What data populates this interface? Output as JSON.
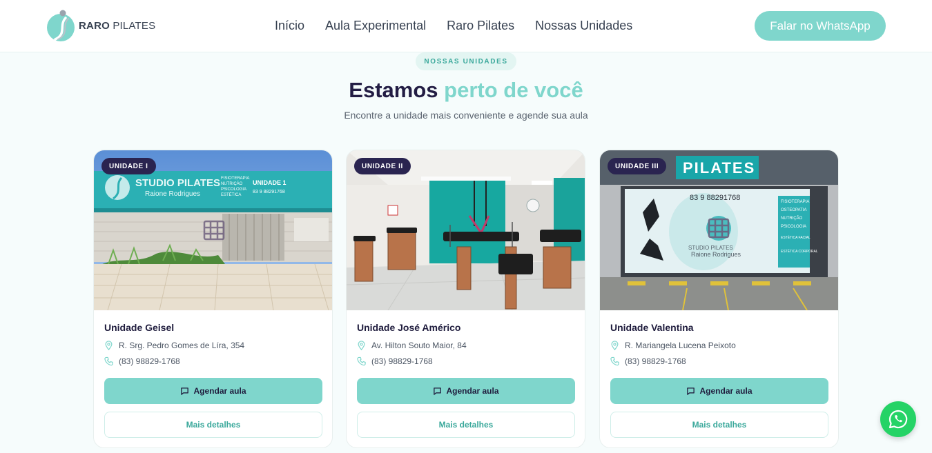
{
  "header": {
    "logo_bold": "RARO",
    "logo_light": "PILATES",
    "nav": [
      "Início",
      "Aula Experimental",
      "Raro Pilates",
      "Nossas Unidades"
    ],
    "cta_label": "Falar no WhatsApp"
  },
  "section": {
    "badge": "NOSSAS UNIDADES",
    "title_main": "Estamos",
    "title_accent": "perto de você",
    "subtitle": "Encontre a unidade mais conveniente e agende sua aula"
  },
  "units": [
    {
      "tag": "UNIDADE I",
      "name": "Unidade Geisel",
      "address": "R. Srg. Pedro Gomes de Líra, 354",
      "phone": "(83) 98829-1768",
      "primary_label": "Agendar aula",
      "secondary_label": "Mais detalhes"
    },
    {
      "tag": "UNIDADE II",
      "name": "Unidade José Américo",
      "address": "Av. Hilton Souto Maior, 84",
      "phone": "(83) 98829-1768",
      "primary_label": "Agendar aula",
      "secondary_label": "Mais detalhes"
    },
    {
      "tag": "UNIDADE III",
      "name": "Unidade Valentina",
      "address": "R. Mariangela Lucena Peixoto",
      "phone": "(83) 98829-1768",
      "primary_label": "Agendar aula",
      "secondary_label": "Mais detalhes"
    }
  ],
  "photo_signage": {
    "storefront_1": [
      "STUDIO PILATES",
      "Raione Rodrigues",
      "FISIOTERAPIA",
      "NUTRIÇÃO",
      "PSICOLOGIA",
      "ESTÉTICA",
      "UNIDADE 1",
      "83 9 88291768"
    ],
    "storefront_3": [
      "PILATES",
      "83 9 88291768",
      "STUDIO PILATES",
      "Raione Rodrigues",
      "FISIOTERAPIA",
      "OSTEOPATIA",
      "NUTRIÇÃO",
      "PSICOLOGIA",
      "ESTÉTICA FACIAL",
      "ESTÉTICA CORPORAL"
    ]
  },
  "icons": {
    "location": "map-pin-icon",
    "phone": "phone-icon",
    "chat": "message-square-icon",
    "whatsapp": "whatsapp-icon"
  },
  "colors": {
    "accent": "#7fd6cc",
    "navy": "#231d44",
    "whatsapp": "#25d366",
    "teal_text": "#3aa89b"
  }
}
